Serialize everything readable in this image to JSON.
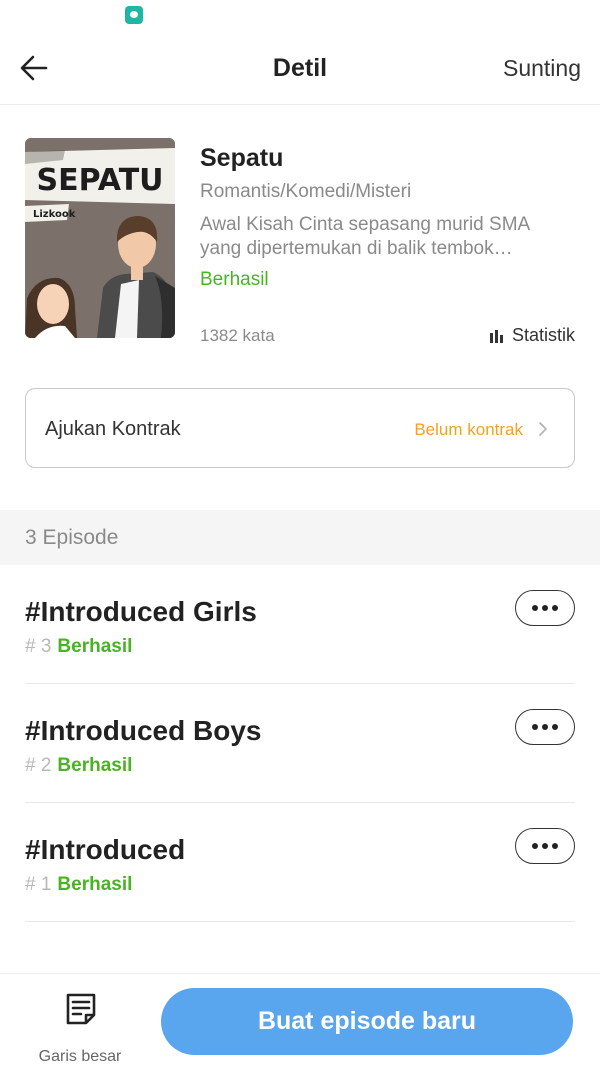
{
  "header": {
    "title": "Detil",
    "edit_label": "Sunting"
  },
  "book": {
    "title": "Sepatu",
    "genre": "Romantis/Komedi/Misteri",
    "description": "Awal Kisah Cinta sepasang murid SMA yang dipertemukan di balik tembok…",
    "status": "Berhasil",
    "word_count": "1382 kata",
    "stats_label": "Statistik",
    "cover": {
      "title": "SEPATU",
      "author": "Lizkook"
    }
  },
  "contract": {
    "label": "Ajukan Kontrak",
    "status": "Belum kontrak"
  },
  "episodes": {
    "count_label": "3 Episode",
    "items": [
      {
        "title": "#Introduced Girls",
        "number": "# 3",
        "status": "Berhasil"
      },
      {
        "title": "#Introduced Boys",
        "number": "# 2",
        "status": "Berhasil"
      },
      {
        "title": "#Introduced",
        "number": "# 1",
        "status": "Berhasil"
      }
    ]
  },
  "footer": {
    "outline_label": "Garis besar",
    "create_label": "Buat episode baru"
  },
  "colors": {
    "accent": "#5aa6ee",
    "success": "#49b423",
    "warning": "#f2a126"
  }
}
